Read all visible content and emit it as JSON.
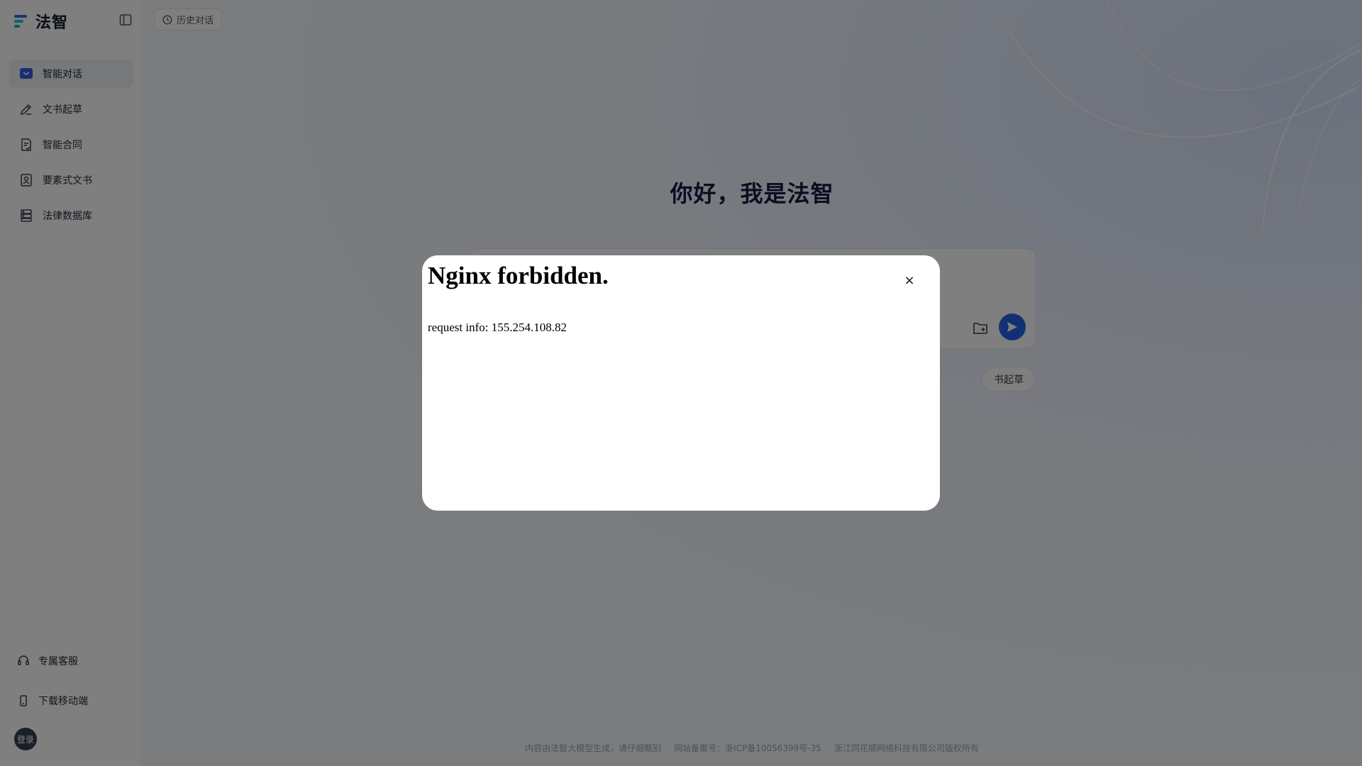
{
  "app": {
    "brand": "法智",
    "history_label": "历史对话"
  },
  "sidebar": {
    "items": [
      {
        "label": "智能对话",
        "icon": "chat-icon",
        "active": true
      },
      {
        "label": "文书起草",
        "icon": "edit-icon",
        "active": false
      },
      {
        "label": "智能合同",
        "icon": "contract-icon",
        "active": false
      },
      {
        "label": "要素式文书",
        "icon": "element-doc-icon",
        "active": false
      },
      {
        "label": "法律数据库",
        "icon": "database-icon",
        "active": false
      }
    ],
    "bottom": [
      {
        "label": "专属客服",
        "icon": "headset-icon"
      },
      {
        "label": "下载移动端",
        "icon": "mobile-icon"
      }
    ],
    "login_label": "登录"
  },
  "main": {
    "greeting": "你好，我是法智",
    "chip_partial": "书起草",
    "footer": [
      "内容由法智大模型生成，请仔细甄别",
      "网站备案号：浙ICP备10056399号-35",
      "浙江同花顺网络科技有限公司版权所有"
    ]
  },
  "modal": {
    "title": "Nginx forbidden.",
    "info": "request info: 155.254.108.82",
    "close_glyph": "×"
  },
  "colors": {
    "accent": "#2563eb",
    "brand_logo": [
      "#2f6bff",
      "#22c1d6",
      "#14b8a6"
    ],
    "overlay": "rgba(0,0,0,0.5)"
  }
}
